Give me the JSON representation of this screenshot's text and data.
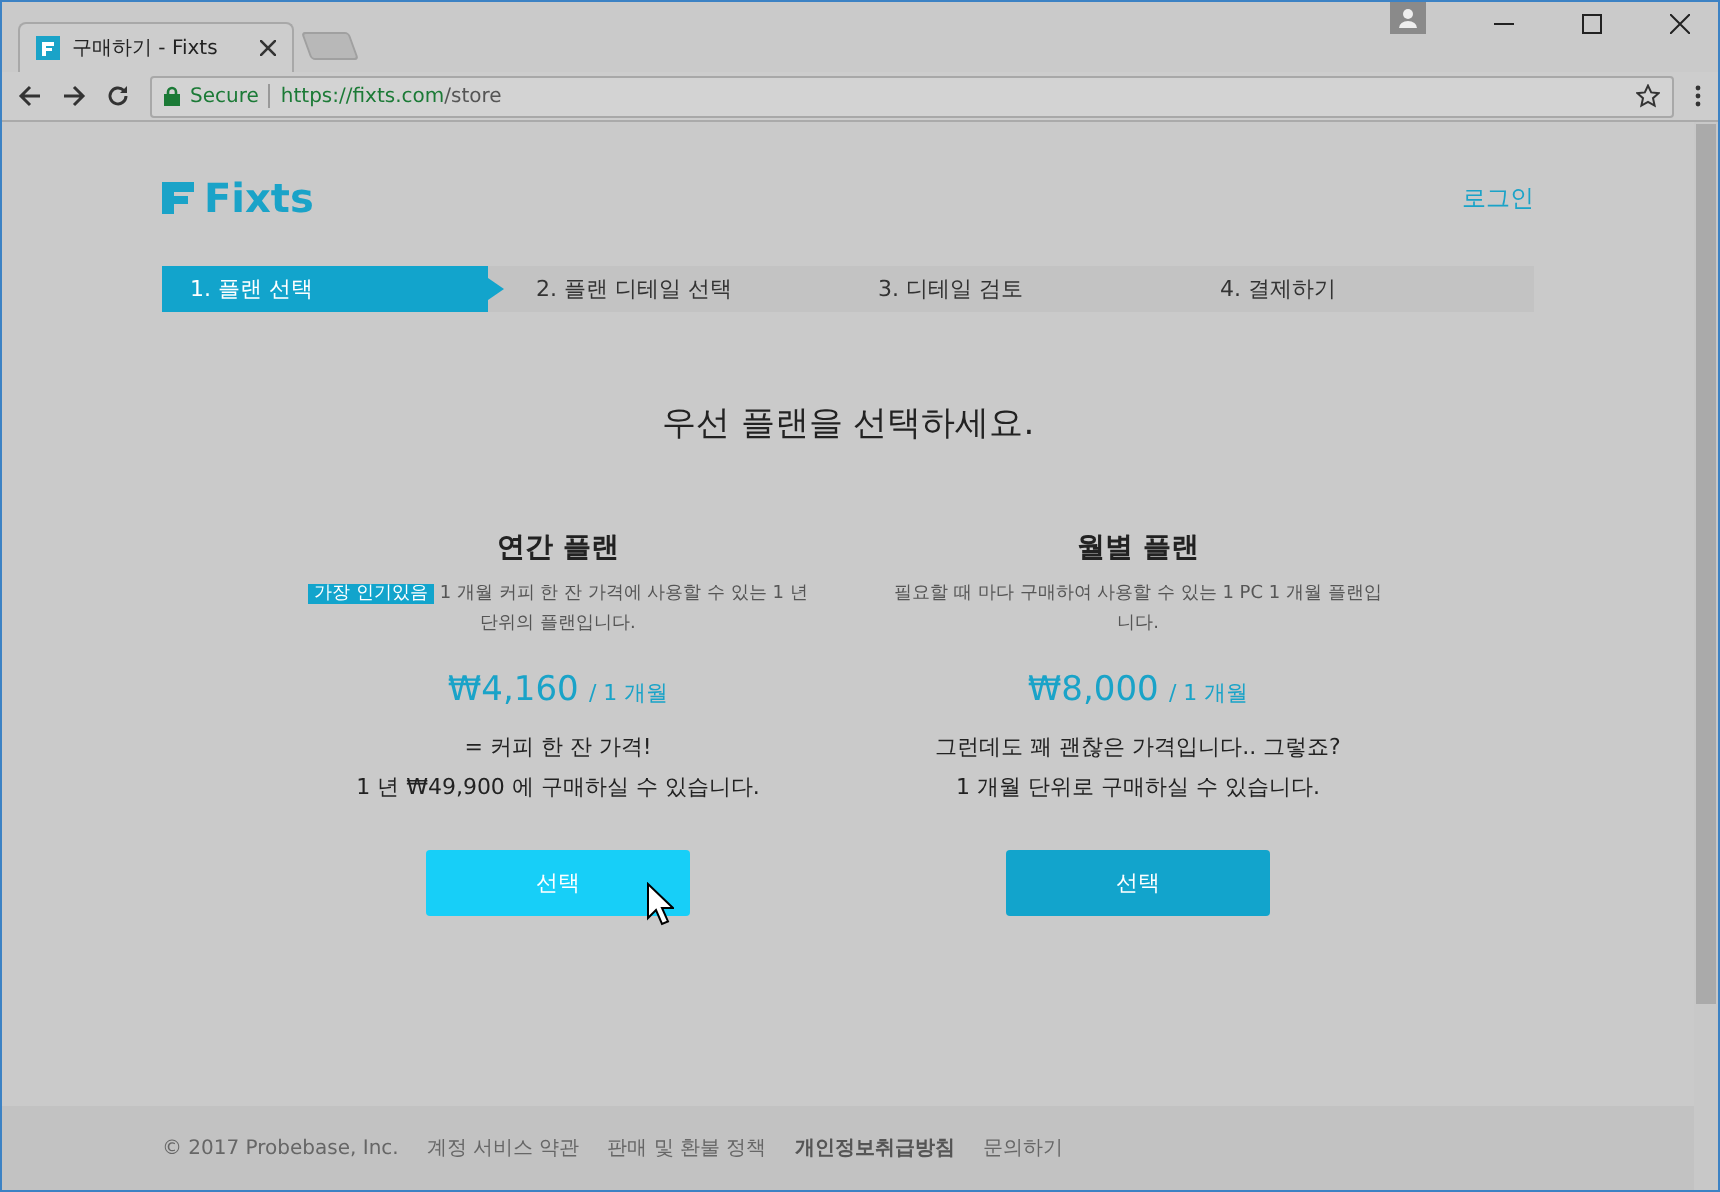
{
  "browser": {
    "tab_title": "구매하기 - Fixts",
    "secure_label": "Secure",
    "url_host": "https://fixts.com",
    "url_path": "/store"
  },
  "header": {
    "logo": "Fixts",
    "login": "로그인"
  },
  "steps": [
    {
      "label": "1. 플랜 선택",
      "selected": true
    },
    {
      "label": "2. 플랜 디테일 선택",
      "selected": false
    },
    {
      "label": "3. 디테일 검토",
      "selected": false
    },
    {
      "label": "4. 결제하기",
      "selected": false
    }
  ],
  "heading": "우선 플랜을 선택하세요.",
  "plans": [
    {
      "title": "연간 플랜",
      "badge": "가장 인기있음",
      "description": "1 개월 커피 한 잔 가격에 사용할 수 있는 1 년 단위의 플랜입니다.",
      "price": "₩4,160",
      "period": "/ 1 개월",
      "notes": [
        "= 커피 한 잔 가격!",
        "1 년 ₩49,900 에 구매하실 수 있습니다."
      ],
      "button": "선택",
      "hovered": true
    },
    {
      "title": "월별 플랜",
      "description": "필요할 때 마다 구매하여 사용할 수 있는 1 PC 1 개월 플랜입니다.",
      "price": "₩8,000",
      "period": "/ 1 개월",
      "notes": [
        "그런데도 꽤 괜찮은 가격입니다.. 그렇죠?",
        "1 개월 단위로 구매하실 수 있습니다."
      ],
      "button": "선택",
      "hovered": false
    }
  ],
  "footer": [
    {
      "text": "© 2017 Probebase, Inc.",
      "emphasized": false
    },
    {
      "text": "계정 서비스 약관",
      "emphasized": false
    },
    {
      "text": "판매 및 환불 정책",
      "emphasized": false
    },
    {
      "text": "개인정보취급방침",
      "emphasized": true
    },
    {
      "text": "문의하기",
      "emphasized": false
    }
  ]
}
